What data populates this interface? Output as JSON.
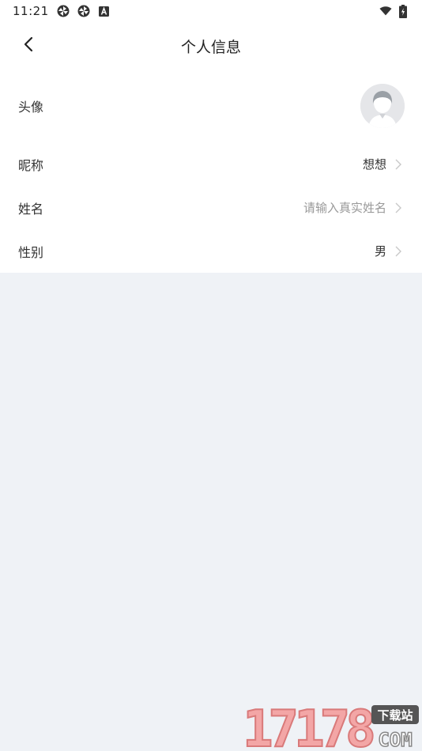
{
  "status_bar": {
    "time": "11:21",
    "left_icons": [
      "pinwheel-icon",
      "pinwheel-icon",
      "font-a-icon"
    ],
    "right_icons": [
      "wifi-icon",
      "battery-charging-icon"
    ]
  },
  "header": {
    "title": "个人信息",
    "back_icon": "chevron-left-icon"
  },
  "profile": {
    "rows": [
      {
        "label": "头像",
        "type": "avatar",
        "icon": "default-avatar-icon"
      },
      {
        "label": "昵称",
        "value": "想想"
      },
      {
        "label": "姓名",
        "placeholder": "请输入真实姓名"
      },
      {
        "label": "性别",
        "value": "男"
      }
    ]
  },
  "watermark": {
    "digits": "17178",
    "brand": "下载站",
    "domain": "COM"
  },
  "colors": {
    "page_bg": "#eff2f6",
    "card_bg": "#ffffff",
    "text_primary": "#333333",
    "text_placeholder": "#999999",
    "chevron": "#c8c8c8",
    "watermark_pink": "#f3a6a6"
  }
}
